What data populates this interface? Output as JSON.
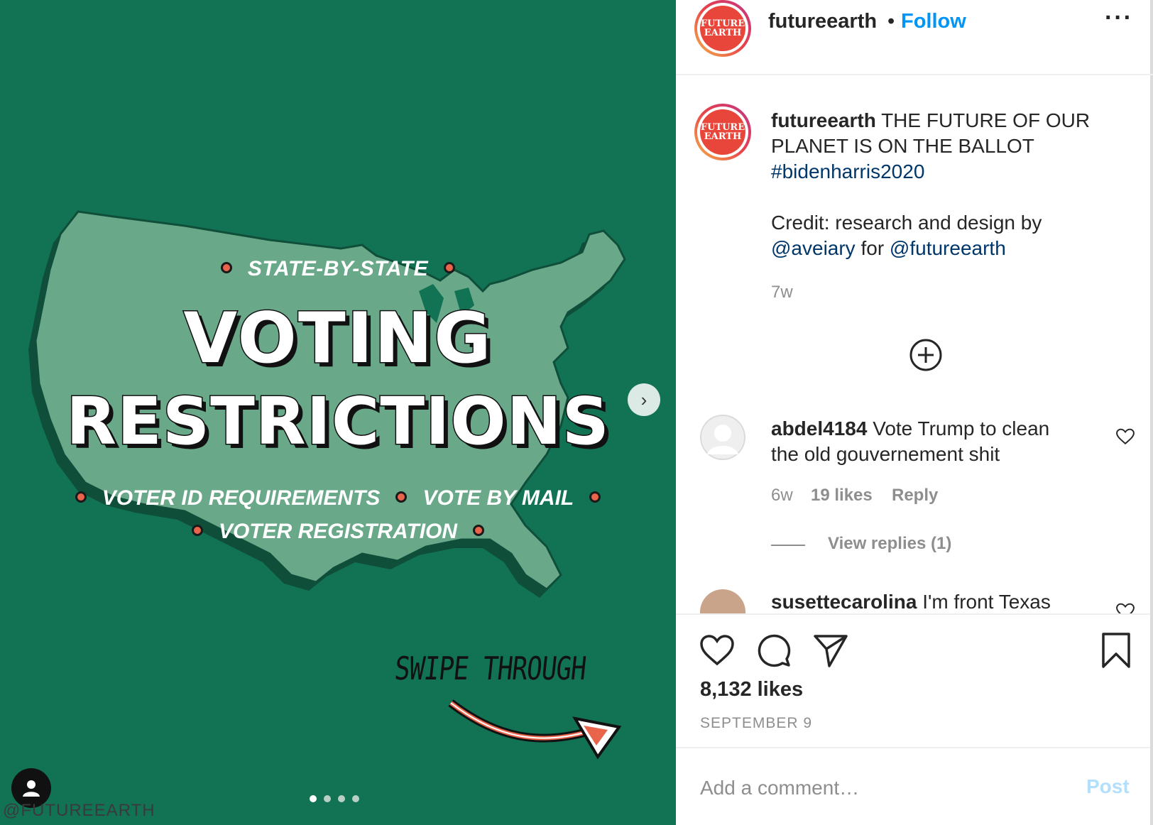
{
  "post_image": {
    "subtitle": "STATE-BY-STATE",
    "title_line1": "VOTING",
    "title_line2": "RESTRICTIONS",
    "topic1": "VOTER ID REQUIREMENTS",
    "topic2": "VOTE BY MAIL",
    "topic3": "VOTER REGISTRATION",
    "swipe_label": "SWIPE THROUGH",
    "watermark": "@FUTUREEARTH",
    "next_arrow": "›",
    "carousel": {
      "count": 4,
      "active_index": 0
    },
    "colors": {
      "background": "#127354",
      "map": "#6aa88a",
      "map_shadow": "#0f4f3a",
      "accent_dot": "#e8644a"
    }
  },
  "header": {
    "logo_line1": "FUTURE",
    "logo_line2": "EARTH",
    "username": "futureearth",
    "separator": "•",
    "follow_label": "Follow",
    "more_label": "···"
  },
  "caption": {
    "username": "futureearth",
    "line1_rest": " THE FUTURE OF OUR",
    "line2": "PLANET IS ON THE BALLOT",
    "hashtag": "#bidenharris2020",
    "credit_text": "Credit: research and design by",
    "mention1": "@aveiary",
    "for_word": " for ",
    "mention2": "@futureearth",
    "time": "7w"
  },
  "comments": [
    {
      "username": "abdel4184",
      "line1_rest": " Vote Trump to clean",
      "line2": "the old gouvernement shit",
      "time": "6w",
      "likes": "19 likes",
      "reply_label": "Reply",
      "view_replies": "View replies (1)"
    },
    {
      "username": "susettecarolina",
      "text_rest": " I'm front Texas"
    }
  ],
  "actions": {
    "likes_count": "8,132 likes",
    "date": "SEPTEMBER 9"
  },
  "comment_box": {
    "placeholder": "Add a comment…",
    "post_label": "Post"
  },
  "icons": [
    "heart-icon",
    "comment-icon",
    "share-icon",
    "bookmark-icon",
    "plus-circle-icon",
    "user-tag-icon",
    "more-icon",
    "chevron-right-icon"
  ]
}
